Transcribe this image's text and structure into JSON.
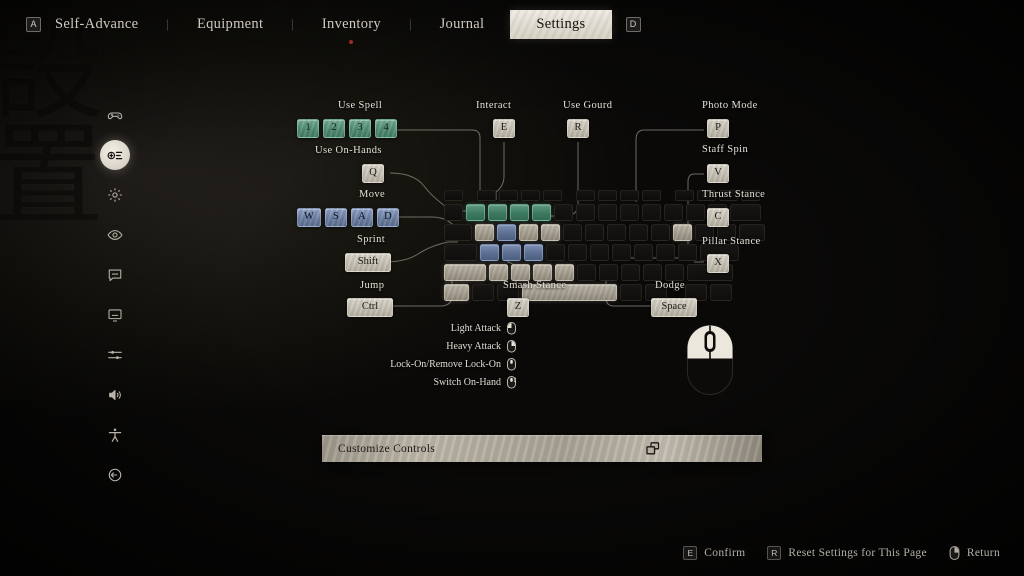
{
  "window": {
    "background_calligraphy": "設置"
  },
  "topnav": {
    "left_key": "A",
    "right_key": "D",
    "separator": "|",
    "items": [
      {
        "label": "Self-Advance",
        "selected": false
      },
      {
        "label": "Equipment",
        "selected": false
      },
      {
        "label": "Inventory",
        "selected": false,
        "has_dot": true
      },
      {
        "label": "Journal",
        "selected": false
      },
      {
        "label": "Settings",
        "selected": true
      }
    ]
  },
  "sidebar": {
    "items": [
      {
        "name": "gamepad-icon",
        "label": "Controller",
        "selected": false
      },
      {
        "name": "keyboard-icon",
        "label": "Keyboard and Mouse",
        "selected": true
      },
      {
        "name": "gear-icon",
        "label": "Gameplay",
        "selected": false
      },
      {
        "name": "eye-icon",
        "label": "Display",
        "selected": false
      },
      {
        "name": "subtitle-icon",
        "label": "Subtitles",
        "selected": false
      },
      {
        "name": "monitor-icon",
        "label": "Graphics",
        "selected": false
      },
      {
        "name": "sliders-icon",
        "label": "Advanced",
        "selected": false
      },
      {
        "name": "volume-icon",
        "label": "Audio",
        "selected": false
      },
      {
        "name": "accessibility-icon",
        "label": "Accessibility",
        "selected": false
      },
      {
        "name": "exit-icon",
        "label": "Exit",
        "selected": false
      }
    ]
  },
  "keyboard": {
    "callouts_left": [
      {
        "title": "Use Spell",
        "keys": [
          "1",
          "2",
          "3",
          "4"
        ],
        "style": "green"
      },
      {
        "title": "Use On-Hands",
        "keys": [
          "Q"
        ],
        "style": "stone"
      },
      {
        "title": "Move",
        "keys": [
          "W",
          "S",
          "A",
          "D"
        ],
        "style": "blue"
      },
      {
        "title": "Sprint",
        "keys": [
          "Shift"
        ],
        "style": "stone"
      },
      {
        "title": "Jump",
        "keys": [
          "Ctrl"
        ],
        "style": "stone"
      }
    ],
    "callouts_top": [
      {
        "title": "Interact",
        "keys": [
          "E"
        ],
        "style": "stone"
      },
      {
        "title": "Use Gourd",
        "keys": [
          "R"
        ],
        "style": "stone"
      }
    ],
    "callouts_right": [
      {
        "title": "Photo Mode",
        "keys": [
          "P"
        ],
        "style": "stone"
      },
      {
        "title": "Staff Spin",
        "keys": [
          "V"
        ],
        "style": "stone"
      },
      {
        "title": "Thrust Stance",
        "keys": [
          "C"
        ],
        "style": "stone"
      },
      {
        "title": "Pillar Stance",
        "keys": [
          "X"
        ],
        "style": "stone"
      }
    ],
    "callouts_bottom": [
      {
        "title": "Smash Stance",
        "keys": [
          "Z"
        ],
        "style": "stone"
      },
      {
        "title": "Dodge",
        "keys": [
          "Space"
        ],
        "style": "stone"
      }
    ]
  },
  "mouse": {
    "bindings": [
      {
        "label": "Light Attack",
        "button": "left-button"
      },
      {
        "label": "Heavy Attack",
        "button": "right-button"
      },
      {
        "label": "Lock-On/Remove Lock-On",
        "button": "middle-button"
      },
      {
        "label": "Switch On-Hand",
        "button": "scroll-wheel"
      }
    ]
  },
  "customize": {
    "label": "Customize Controls",
    "icon": "windows-overlap-icon"
  },
  "bottombar": {
    "items": [
      {
        "key": "E",
        "label": "Confirm",
        "icon": "key-badge"
      },
      {
        "key": "R",
        "label": "Reset Settings for This Page",
        "icon": "key-badge"
      },
      {
        "key": "",
        "label": "Return",
        "icon": "mouse-right-icon"
      }
    ]
  },
  "colors": {
    "accent_green": "#4e8a70",
    "accent_blue": "#6a7d9f",
    "accent_stone": "#c4bfb2",
    "background": "#0a0908",
    "text": "#e8e4dc"
  }
}
